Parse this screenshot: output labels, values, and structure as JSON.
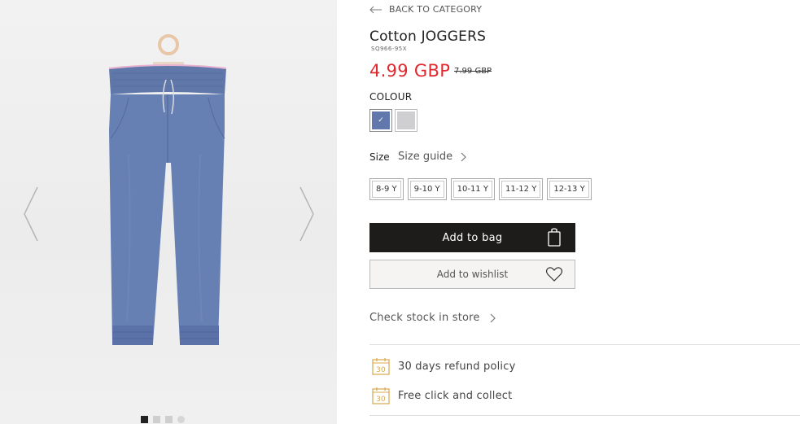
{
  "gallery": {
    "image_alt": "blue cotton joggers on hanger",
    "dots": [
      "1",
      "2",
      "3",
      "4"
    ],
    "active_dot": 1
  },
  "product": {
    "back_label": "BACK TO CATEGORY",
    "title": "Cotton JOGGERS",
    "sku": "SQ966-95X",
    "price": "4.99 GBP",
    "old_price": "7.99 GBP",
    "price_color": "#e0282e"
  },
  "colour": {
    "label": "COLOUR",
    "swatches": [
      {
        "name": "blue",
        "hex": "#6277ab",
        "selected": true,
        "check": "✓"
      },
      {
        "name": "grey",
        "hex": "#cfcfd1",
        "selected": false
      }
    ]
  },
  "size": {
    "label": "Size",
    "guide_label": "Size guide",
    "options": [
      "8-9 Y",
      "9-10 Y",
      "10-11 Y",
      "11-12 Y",
      "12-13 Y"
    ]
  },
  "actions": {
    "add_to_bag": "Add to bag",
    "add_to_wishlist": "Add to wishlist",
    "check_stock": "Check stock in store"
  },
  "perks": [
    {
      "icon": "calendar-30-icon",
      "icon_text": "30",
      "label": "30 days refund policy"
    },
    {
      "icon": "calendar-30-icon",
      "icon_text": "30",
      "label": "Free click and collect"
    }
  ],
  "colors": {
    "accent": "#e0282e",
    "button_dark": "#1e1c1b",
    "icon_gold": "#d8a84a"
  }
}
